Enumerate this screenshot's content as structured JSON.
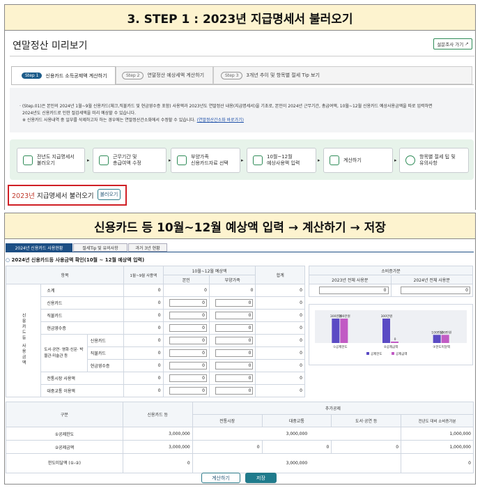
{
  "banner1": "3. STEP 1 : 2023년 지급명세서 불러오기",
  "banner2": "신용카드 등 10월~12월 예상액 입력 → 계산하기 → 저장",
  "app": {
    "title": "연말정산 미리보기",
    "survey_button": "설문조사 가기"
  },
  "tabs": [
    {
      "step": "Step 1",
      "label": "신용카드 소득공제액 계산하기"
    },
    {
      "step": "Step 2",
      "label": "연말정산 예상세액 계산하기"
    },
    {
      "step": "Step 3",
      "label": "3개년 추이 및 항목별 절세 Tip 보기"
    }
  ],
  "notice": {
    "line1": "(Step.01)은 본인의 2024년 1월~9월 신용카드(체크,직불카드 및 현금영수증 포함) 사용액과 2023년도 연말정산 내용(지급명세서)을 기초로, 본인이 2024년 근무기간, 총급여액, 10월~12월 신용카드 예상사용금액을 따로 입력하면",
    "line2": "2024년도 신용카드로 인한 절감세액을 미리 예상할 수 있습니다.",
    "line3": "※ 신용카드 사용내역 중 일부를 삭제하고자 하는 경우에는 연말정산간소화에서 수정할 수 있습니다.",
    "link": "(연말정산간소화 바로가기)"
  },
  "steps": [
    {
      "icon": "document-icon",
      "line1": "전년도 지급명세서",
      "line2": "불러오기"
    },
    {
      "icon": "calendar-icon",
      "line1": "근무기간 및",
      "line2": "총급여액 수정"
    },
    {
      "icon": "family-icon",
      "line1": "부양가족",
      "line2": "신용카드자료 선택"
    },
    {
      "icon": "card-icon",
      "line1": "10월~12월",
      "line2": "예상사용액 입력"
    },
    {
      "icon": "calculator-icon",
      "line1": "계산하기",
      "line2": ""
    },
    {
      "icon": "tip-icon",
      "line1": "항목별 절세 팁 및",
      "line2": "유의사항"
    }
  ],
  "load_section": {
    "year": "2023년",
    "label": "지급명세서 불러오기",
    "button": "불러오기"
  },
  "subtabs": [
    "2024년 신용카드 사용현황",
    "절세Tip 및 유의사항",
    "과거 3년 현황"
  ],
  "section_title": "2024년 신용카드등 사용금액 확인(10월 ~ 12월 예상액 입력)",
  "usage_table": {
    "h_item": "항목",
    "h_jan_sep": "1월~9월 사용액",
    "h_oct_dec": "10월~12월 예상액",
    "h_self": "본인",
    "h_dependent": "부양가족",
    "h_total": "합계",
    "side_label": "신용카드등 사용금액",
    "culture_label": "도서·공연· 영화·신문· 박물관·미술관 등",
    "rows": [
      {
        "label": "소계",
        "jan_sep": "0",
        "self": "0",
        "dep": "0",
        "total": "0"
      },
      {
        "label": "신용카드",
        "jan_sep": "0",
        "self": "0",
        "dep": "0",
        "total": "0"
      },
      {
        "label": "직불카드",
        "jan_sep": "0",
        "self": "0",
        "dep": "0",
        "total": "0"
      },
      {
        "label": "현금영수증",
        "jan_sep": "0",
        "self": "0",
        "dep": "0",
        "total": "0"
      },
      {
        "label": "신용카드",
        "jan_sep": "0",
        "self": "0",
        "dep": "0",
        "total": "0"
      },
      {
        "label": "직불카드",
        "jan_sep": "0",
        "self": "0",
        "dep": "0",
        "total": "0"
      },
      {
        "label": "현금영수증",
        "jan_sep": "0",
        "self": "0",
        "dep": "0",
        "total": "0"
      },
      {
        "label": "전통시장 사용액",
        "jan_sep": "0",
        "self": "0",
        "dep": "0",
        "total": "0"
      },
      {
        "label": "대중교통 이용액",
        "jan_sep": "0",
        "self": "0",
        "dep": "0",
        "total": "0"
      }
    ]
  },
  "consumption": {
    "title": "소비증가분",
    "h_2023": "2023년 전체 사용분",
    "h_2024": "2024년 전체 사용분",
    "v_2023": "0",
    "v_2024": "0"
  },
  "chart_data": {
    "type": "bar",
    "categories": [
      "①공제한도",
      "②공제금액",
      "③한도미달액"
    ],
    "series": [
      {
        "name": "공제한도",
        "values": [
          300,
          300,
          100
        ],
        "color": "#5b4bc4"
      },
      {
        "name": "공제금액",
        "values": [
          300,
          0,
          100
        ],
        "color": "#c15bc4"
      }
    ],
    "bar_labels": [
      "300만원",
      "300만원",
      "300만원",
      "0",
      "100만원",
      "100만원"
    ],
    "ylim": [
      0,
      300
    ]
  },
  "deduction_table": {
    "h_div": "구분",
    "h_card": "신용카드 등",
    "h_additional": "추가공제",
    "h_market": "전통시장",
    "h_transit": "대중교통",
    "h_culture": "도서·공연 등",
    "h_increase": "전년도 대비 소비증가분",
    "rows": [
      {
        "label": "①공제한도",
        "card": "3,000,000",
        "merged": "3,000,000",
        "inc": "1,000,000"
      },
      {
        "label": "②공제금액",
        "card": "3,000,000",
        "market": "0",
        "transit": "0",
        "culture": "0",
        "inc": "1,000,000"
      },
      {
        "label": "한도미달액 (①-②)",
        "card": "0",
        "merged": "3,000,000",
        "inc": "0"
      }
    ]
  },
  "buttons": {
    "calc": "계산하기",
    "save": "저장"
  }
}
